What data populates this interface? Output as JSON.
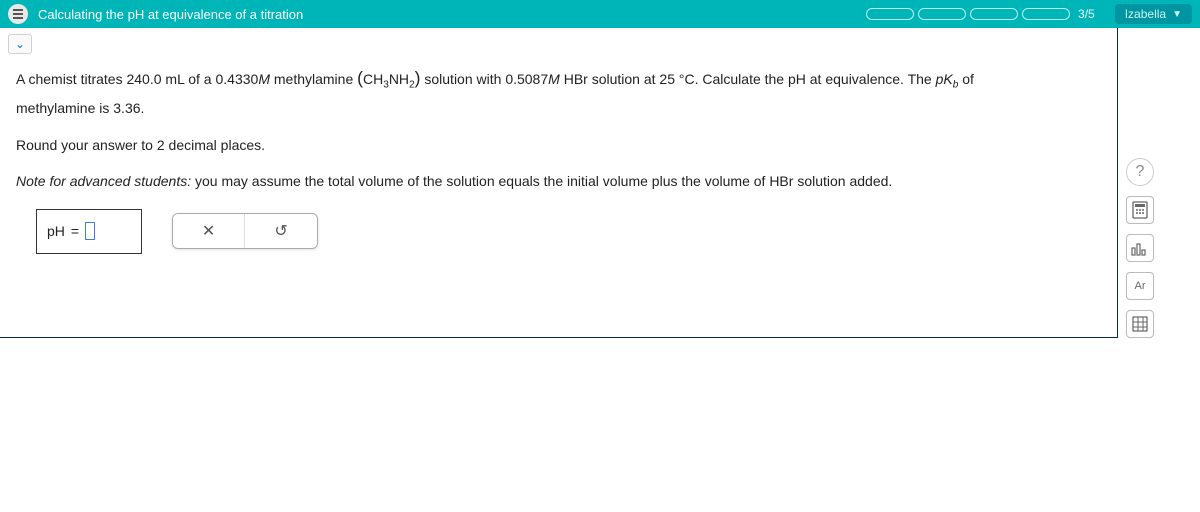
{
  "topbar": {
    "title": "Calculating the pH at equivalence of a titration",
    "progress_text": "3/5",
    "user_name": "Izabella"
  },
  "question": {
    "line1_a": "A chemist titrates ",
    "vol_base": "240.0 mL",
    "line1_b": " of a ",
    "conc_base": "0.4330",
    "unit_M": "M",
    "line1_c": " methylamine ",
    "formula_open": "(",
    "formula_ch3": "CH",
    "formula_3": "3",
    "formula_nh": "NH",
    "formula_2": "2",
    "formula_close": ")",
    "line1_d": " solution with ",
    "conc_acid": "0.5087",
    "line1_e": " HBr solution at ",
    "temp": "25 °C",
    "line1_f": ". Calculate the pH at equivalence. The ",
    "pk_label_p": "p",
    "pk_label_K": "K",
    "pk_label_b": "b",
    "line1_g": " of",
    "line2_a": "methylamine is ",
    "pkb_value": "3.36",
    "line2_b": ".",
    "round_a": "Round your answer to ",
    "round_places": "2",
    "round_b": " decimal places.",
    "note_label": "Note for advanced students:",
    "note_text": " you may assume the total volume of the solution equals the initial volume plus the volume of HBr solution added."
  },
  "answer": {
    "label_pH": "pH",
    "label_eq": "="
  },
  "tools": {
    "help": "?",
    "argon": "Ar"
  }
}
